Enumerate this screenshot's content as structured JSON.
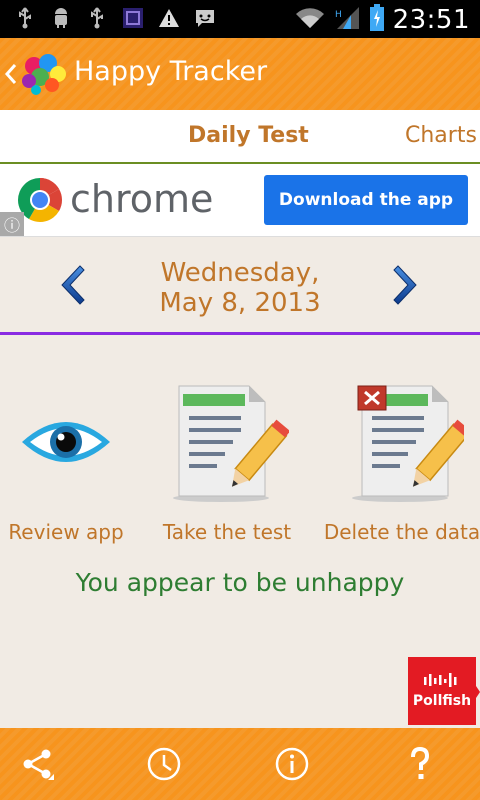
{
  "status_bar": {
    "time": "23:51",
    "left_icons": [
      "usb-icon",
      "android-debug-icon",
      "usb-icon",
      "app-notification-icon",
      "warning-icon",
      "message-icon"
    ],
    "right_icons": [
      "wifi-icon",
      "signal-icon",
      "battery-charging-icon"
    ]
  },
  "action_bar": {
    "title": "Happy Tracker"
  },
  "tabs": [
    {
      "label": "Daily Test"
    },
    {
      "label": "Charts"
    }
  ],
  "ad": {
    "brand": "chrome",
    "button": "Download the app"
  },
  "date": {
    "line1": "Wednesday,",
    "line2": "May 8, 2013"
  },
  "actions": [
    {
      "label": "Review app",
      "icon": "eye-icon"
    },
    {
      "label": "Take the test",
      "icon": "edit-document-icon"
    },
    {
      "label": "Delete the data",
      "icon": "delete-document-icon"
    }
  ],
  "status_message": "You appear to be unhappy",
  "pollfish": {
    "label": "Pollfish"
  },
  "bottom_bar": {
    "icons": [
      "share-icon",
      "clock-icon",
      "info-icon",
      "help-icon"
    ]
  },
  "colors": {
    "accent": "#f7941d",
    "text_orange": "#c0762a",
    "message_green": "#2e7d32",
    "divider_purple": "#8a2be2",
    "ad_blue": "#1a73e8",
    "pollfish_red": "#e31b23"
  }
}
